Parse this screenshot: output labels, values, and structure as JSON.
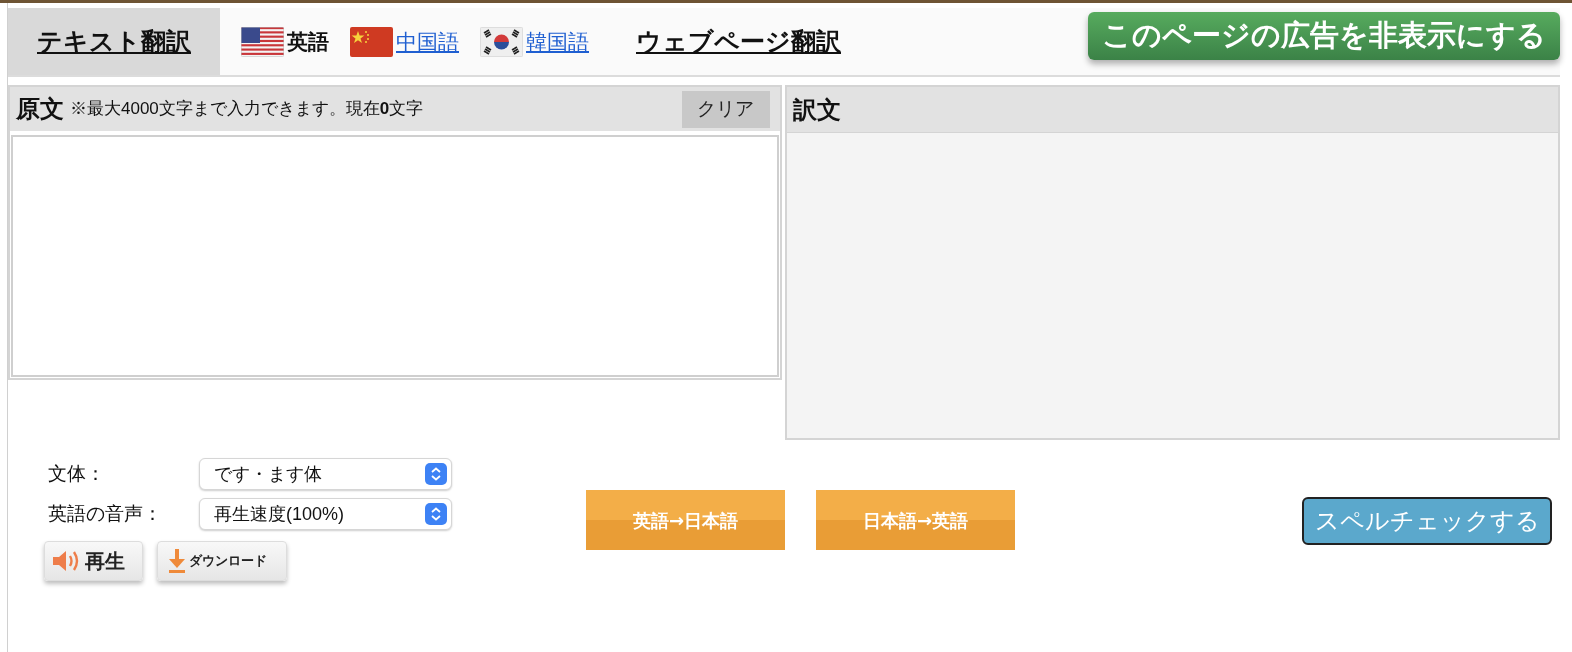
{
  "nav": [
    {
      "kind": "tab",
      "label": "テキスト翻訳",
      "selected": true
    },
    {
      "kind": "us",
      "label": "英語",
      "selected": true
    },
    {
      "kind": "cn",
      "label": "中国語",
      "selected": false
    },
    {
      "kind": "kr",
      "label": "韓国語",
      "selected": false
    },
    {
      "kind": "tab",
      "label": "ウェブページ翻訳",
      "selected": false
    }
  ],
  "ad_button": "このページの広告を非表示にする",
  "source": {
    "title": "原文",
    "note": "※最大4000文字まで入力できます。現在**0**文字",
    "clear_button": "クリア"
  },
  "target": {
    "title": "訳文"
  },
  "options": [
    {
      "label": "文体：",
      "value": "です・ます体"
    },
    {
      "label": "英語の音声：",
      "value": "再生速度(100%)"
    }
  ],
  "audio_buttons": [
    {
      "kind": "play",
      "label": "再生"
    },
    {
      "kind": "download",
      "label": "ダウンロード"
    }
  ],
  "translate_buttons": [
    "英語→日本語",
    "日本語→英語"
  ],
  "spellcheck_button": "スペルチェックする"
}
